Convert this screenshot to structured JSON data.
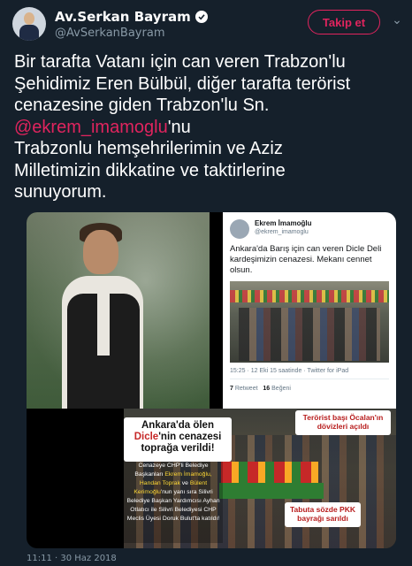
{
  "header": {
    "display_name": "Av.Serkan Bayram",
    "handle": "@AvSerkanBayram",
    "follow_label": "Takip et",
    "accent_color": "#e0245e"
  },
  "tweet": {
    "line1": "Bir tarafta Vatanı için can veren Trabzon'lu",
    "line2": "Şehidimiz Eren Bülbül, diğer tarafta terörist",
    "line3": "cenazesine giden Trabzon'lu Sn.",
    "mention": "@ekrem_imamoglu",
    "line4_suffix": "'nu",
    "line5": "Trabzonlu hemşehrilerimin ve Aziz",
    "line6": "Milletimizin dikkatine ve taktirlerine",
    "line7": "sunuyorum."
  },
  "embedded_tweet": {
    "name": "Ekrem İmamoğlu",
    "handle": "@ekrem_imamoglu",
    "text": "Ankara'da Barış için can veren Dicle Deli kardeşimizin cenazesi. Mekanı cennet olsun.",
    "time": "15:25 · 12 Eki 15 saatinde · Twitter for iPad",
    "retweets": "7",
    "retweets_label": "Retweet",
    "likes": "16",
    "likes_label": "Beğeni"
  },
  "bottom_image": {
    "main_1": "Ankara'da ölen",
    "main_2": "Dicle",
    "main_3": "'nin cenazesi",
    "main_4": "toprağa verildi!",
    "right_box": "Terörist başı Öcalan'ın dövizleri açıldı",
    "bottom_box": "Tabuta sözde PKK bayrağı sarıldı",
    "caption_1": "Cenazeye CHP'li Belediye Başkanları",
    "caption_name_1": "Ekrem İmamoğlu,",
    "caption_2": "Handan Toprak",
    "caption_3": "ve",
    "caption_4": "Bülent Kerimoğlu",
    "caption_5": "'nun yanı sıra Silivri Belediye Başkan Yardımcısı Ayhan Otlatıcı ile Silivri Belediyesi CHP Meclis Üyesi Doruk Bulut'ta katıldı!"
  },
  "footer": {
    "timestamp": "11:11 · 30 Haz 2018"
  }
}
